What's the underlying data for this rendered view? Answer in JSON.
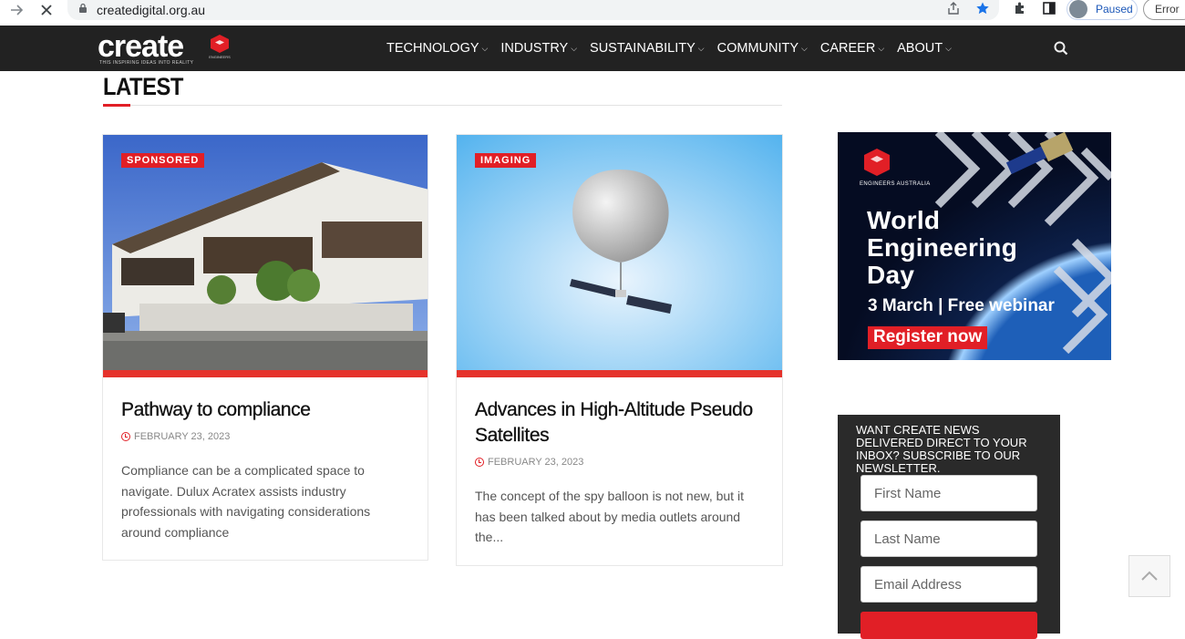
{
  "browser": {
    "url": "createdigital.org.au",
    "profile_status": "Paused",
    "error_label": "Error"
  },
  "site": {
    "logo_text": "create",
    "logo_tagline": "THIS INSPIRING IDEAS INTO REALITY",
    "ea_logo_text": "ENGINEERS AUSTRALIA",
    "nav": [
      {
        "label": "TECHNOLOGY"
      },
      {
        "label": "INDUSTRY"
      },
      {
        "label": "SUSTAINABILITY"
      },
      {
        "label": "COMMUNITY"
      },
      {
        "label": "CAREER"
      },
      {
        "label": "ABOUT"
      }
    ]
  },
  "section": {
    "heading": "LATEST"
  },
  "articles": [
    {
      "badge": "SPONSORED",
      "title": "Pathway to compliance",
      "date": "FEBRUARY 23, 2023",
      "excerpt": "Compliance can be a complicated space to navigate. Dulux Acratex assists industry professionals with navigating considerations around compliance"
    },
    {
      "badge": "IMAGING",
      "title": "Advances in High-Altitude Pseudo Satellites",
      "date": "FEBRUARY 23, 2023",
      "excerpt": "The concept of the spy balloon is not new, but it has been talked about by media outlets around the..."
    }
  ],
  "ad": {
    "logo_text": "ENGINEERS AUSTRALIA",
    "headline_1": "World",
    "headline_2": "Engineering",
    "headline_3": "Day",
    "subline": "3 March | Free webinar",
    "cta": "Register now"
  },
  "newsletter": {
    "heading": "WANT CREATE NEWS DELIVERED DIRECT TO YOUR INBOX? SUBSCRIBE TO OUR NEWSLETTER.",
    "first_name_placeholder": "First Name",
    "last_name_placeholder": "Last Name",
    "email_placeholder": "Email Address"
  },
  "colors": {
    "brand_red": "#e11f26",
    "header_bg": "#222222"
  }
}
